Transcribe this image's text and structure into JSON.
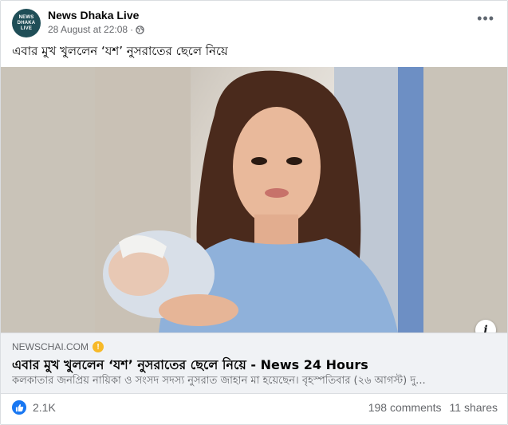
{
  "post": {
    "page_name": "News Dhaka Live",
    "avatar_text": "NEWS DHAKA LIVE",
    "timestamp": "28 August at 22:08",
    "separator": "·",
    "caption": "এবার মুখ খুললেন ‘যশ’ নুসরাতের ছেলে নিয়ে"
  },
  "link_preview": {
    "domain": "NEWSCHAI.COM",
    "title": "এবার মুখ খুললেন ‘যশ’ নুসরাতের ছেলে নিয়ে",
    "source": " - News 24 Hours",
    "description": "কলকাতার জনপ্রিয় নায়িকা ও সংসদ সদস্য নুসরাত জাহান মা হয়েছেন। বৃহস্পতিবার (২৬ আগস্ট) দু..."
  },
  "footer": {
    "likes": "2.1K",
    "comments": "198 comments",
    "shares": "11 shares"
  },
  "icons": {
    "more": "more-options-icon",
    "globe": "globe-icon",
    "info": "info-icon",
    "warning": "warning-icon",
    "like": "like-icon"
  },
  "colors": {
    "accent": "#1877f2",
    "warning": "#f7b928",
    "avatar_bg": "#1f4e57"
  }
}
